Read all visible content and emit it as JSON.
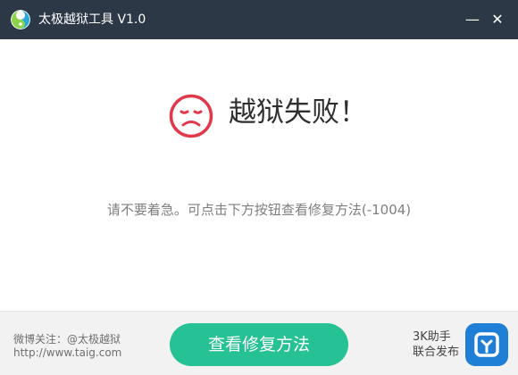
{
  "window": {
    "title": "太极越狱工具 V1.0",
    "minimize_symbol": "—",
    "close_symbol": "✕"
  },
  "main": {
    "status_title": "越狱失败！",
    "hint": "请不要着急。可点击下方按钮查看修复方法(-1004)"
  },
  "footer": {
    "weibo": "微博关注：@太极越狱",
    "site": "http://www.taig.com",
    "fix_button_label": "查看修复方法",
    "partner_line1": "3K助手",
    "partner_line2": "联合发布"
  },
  "colors": {
    "titlebar": "#2d3847",
    "accent": "#26c194",
    "sad_face": "#e0394b",
    "partner_icon": "#1f7fd6"
  },
  "icons": {
    "logo": "taiji-logo-icon",
    "sad": "sad-face-icon",
    "partner": "3k-assistant-icon"
  }
}
